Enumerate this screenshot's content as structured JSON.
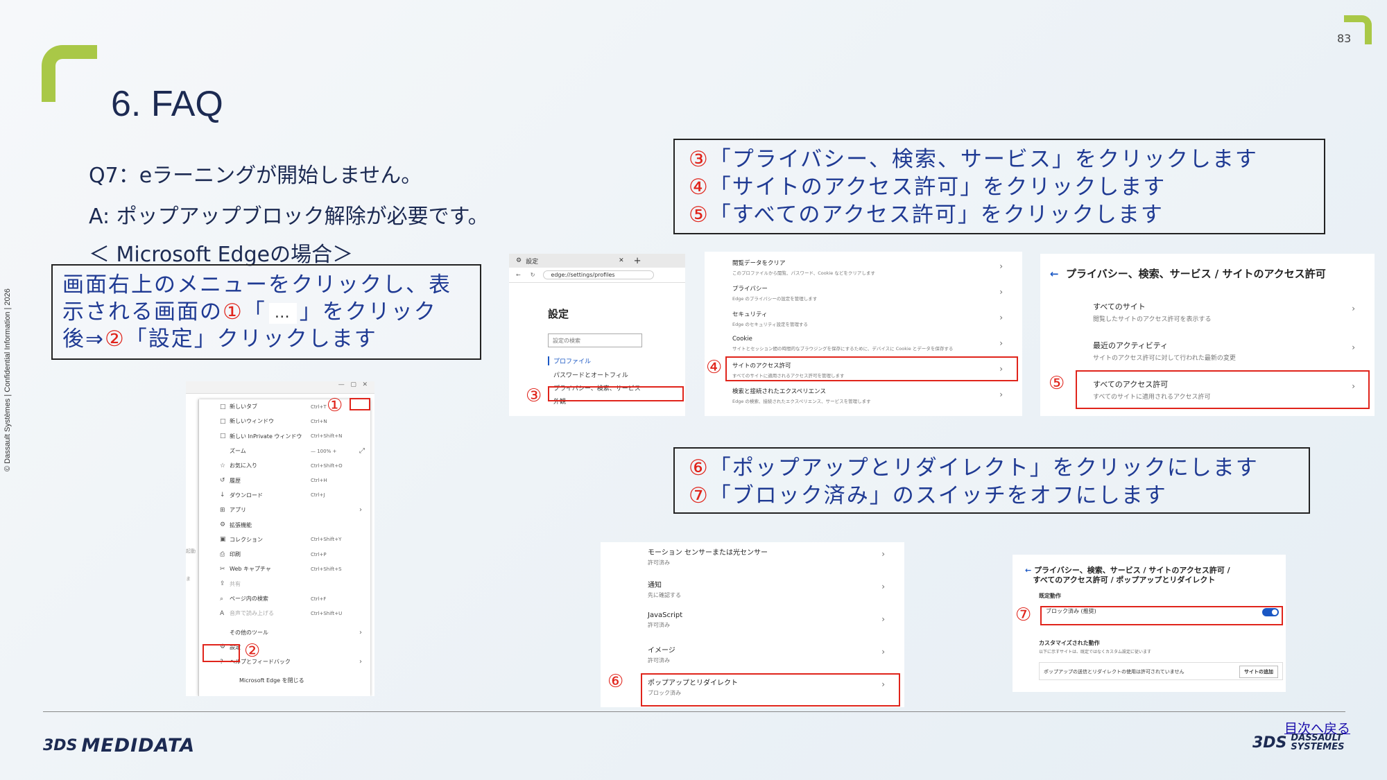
{
  "page": {
    "number": "83",
    "title": "6. FAQ",
    "side_text": "© Dassault Systèmes | Confidential Information | 2026"
  },
  "qa": {
    "question": "Q7：eラーニングが開始しません。",
    "answer": "A: ポップアップブロック解除が必要です。",
    "context": "＜ Microsoft Edgeの場合＞"
  },
  "instruction_left": {
    "line1": "画面右上のメニューをクリックし、表",
    "line2_a": "示される画面の",
    "line2_num": "①",
    "line2_b": "「",
    "chip": "…",
    "line2_c": "」をクリック",
    "line3_a": "後⇒",
    "line3_num": "②",
    "line3_b": "「設定」クリックします"
  },
  "steps_top": [
    {
      "num": "③",
      "text": "「プライバシー、検索、サービス」をクリックします"
    },
    {
      "num": "④",
      "text": "「サイトのアクセス許可」をクリックします"
    },
    {
      "num": "⑤",
      "text": "「すべてのアクセス許可」をクリックします"
    }
  ],
  "steps_bottom": [
    {
      "num": "⑥",
      "text": "「ポップアップとリダイレクト」をクリックにします"
    },
    {
      "num": "⑦",
      "text": "「ブロック済み」のスイッチをオフにします"
    }
  ],
  "markers": {
    "m1": "①",
    "m2": "②",
    "m3": "③",
    "m4": "④",
    "m5": "⑤",
    "m6": "⑥",
    "m7": "⑦"
  },
  "menu_shot": {
    "items": [
      {
        "icon": "□",
        "label": "新しいタブ",
        "shortcut": "Ctrl+T",
        "arrow": ""
      },
      {
        "icon": "□",
        "label": "新しいウィンドウ",
        "shortcut": "Ctrl+N",
        "arrow": ""
      },
      {
        "icon": "□",
        "label": "新しい InPrivate ウィンドウ",
        "shortcut": "Ctrl+Shift+N",
        "arrow": ""
      },
      {
        "icon": "",
        "label": "ズーム",
        "shortcut": "—  100%  +",
        "arrow": "⤢"
      },
      {
        "icon": "☆",
        "label": "お気に入り",
        "shortcut": "Ctrl+Shift+O",
        "arrow": ""
      },
      {
        "icon": "↺",
        "label": "履歴",
        "shortcut": "Ctrl+H",
        "arrow": ""
      },
      {
        "icon": "↓",
        "label": "ダウンロード",
        "shortcut": "Ctrl+J",
        "arrow": ""
      },
      {
        "icon": "⊞",
        "label": "アプリ",
        "shortcut": "",
        "arrow": "›"
      },
      {
        "icon": "⚙",
        "label": "拡張機能",
        "shortcut": "",
        "arrow": ""
      },
      {
        "icon": "▣",
        "label": "コレクション",
        "shortcut": "Ctrl+Shift+Y",
        "arrow": ""
      },
      {
        "icon": "⎙",
        "label": "印刷",
        "shortcut": "Ctrl+P",
        "arrow": ""
      },
      {
        "icon": "✂",
        "label": "Web キャプチャ",
        "shortcut": "Ctrl+Shift+S",
        "arrow": ""
      },
      {
        "icon": "⇪",
        "label": "共有",
        "shortcut": "",
        "arrow": ""
      },
      {
        "icon": "⌕",
        "label": "ページ内の検索",
        "shortcut": "Ctrl+F",
        "arrow": ""
      },
      {
        "icon": "A",
        "label": "音声で読み上げる",
        "shortcut": "Ctrl+Shift+U",
        "arrow": ""
      },
      {
        "icon": "",
        "label": "その他のツール",
        "shortcut": "",
        "arrow": "›"
      },
      {
        "icon": "⚙",
        "label": "設定",
        "shortcut": "",
        "arrow": ""
      },
      {
        "icon": "?",
        "label": "ヘルプとフィードバック",
        "shortcut": "",
        "arrow": "›"
      },
      {
        "icon": "",
        "label": "Microsoft Edge を閉じる",
        "shortcut": "",
        "arrow": ""
      }
    ],
    "side_labels": [
      "起動",
      "ま"
    ]
  },
  "settings_shot": {
    "tab": "設定",
    "address": "edge://settings/profiles",
    "heading": "設定",
    "search_placeholder": "設定の検索",
    "nav": [
      "プロファイル",
      "パスワードとオートフィル",
      "プライバシー、検索、サービス",
      "外観"
    ]
  },
  "privacy_shot": {
    "rows": [
      {
        "title": "閲覧データをクリア",
        "sub": "このプロファイルから閲覧、パスワード、Cookie などをクリアします"
      },
      {
        "title": "プライバシー",
        "sub": "Edge のプライバシーの設定を管理します"
      },
      {
        "title": "セキュリティ",
        "sub": "Edge のセキュリティ設定を管理する"
      },
      {
        "title": "Cookie",
        "sub": "サイトとセッション間の時間的なブラウジングを保存にするために、デバイスに Cookie とデータを保存する"
      },
      {
        "title": "サイトのアクセス許可",
        "sub": "すべてのサイトに適用されるアクセス許可を管理します"
      },
      {
        "title": "検索と接続されたエクスペリエンス",
        "sub": "Edge の検索、接続されたエクスペリエンス、サービスを管理します"
      }
    ]
  },
  "site_perm_shot": {
    "title": "プライバシー、検索、サービス / サイトのアクセス許可",
    "rows": [
      {
        "title": "すべてのサイト",
        "sub": "閲覧したサイトのアクセス許可を表示する"
      },
      {
        "title": "最近のアクティビティ",
        "sub": "サイトのアクセス許可に対して行われた最新の変更"
      },
      {
        "title": "すべてのアクセス許可",
        "sub": "すべてのサイトに適用されるアクセス許可"
      }
    ]
  },
  "popup_shot": {
    "rows": [
      {
        "title": "モーション センサーまたは光センサー",
        "sub": "許可済み"
      },
      {
        "title": "通知",
        "sub": "先に確認する"
      },
      {
        "title": "JavaScript",
        "sub": "許可済み"
      },
      {
        "title": "イメージ",
        "sub": "許可済み"
      },
      {
        "title": "ポップアップとリダイレクト",
        "sub": "ブロック済み"
      }
    ]
  },
  "toggle_shot": {
    "title1": "プライバシー、検索、サービス / サイトのアクセス許可 /",
    "title2": "すべてのアクセス許可 / ポップアップとリダイレクト",
    "section": "既定動作",
    "toggle_label": "ブロック済み (推奨)",
    "custom_heading": "カスタマイズされた動作",
    "custom_sub": "以下に示すサイトは、既定ではなくカスタム設定に従います",
    "custom_row": "ポップアップの送信とリダイレクトの使用は許可されていません",
    "add_button": "サイトの追加"
  },
  "footer": {
    "back_link": "目次へ戻る",
    "logo_left": "MEDIDATA",
    "logo_right_1": "DASSAULT",
    "logo_right_2": "SYSTEMES",
    "logo_mark": "3DS"
  },
  "colors": {
    "accent_green": "#a9c847",
    "step_blue": "#1f3a93",
    "marker_red": "#e0241b"
  }
}
